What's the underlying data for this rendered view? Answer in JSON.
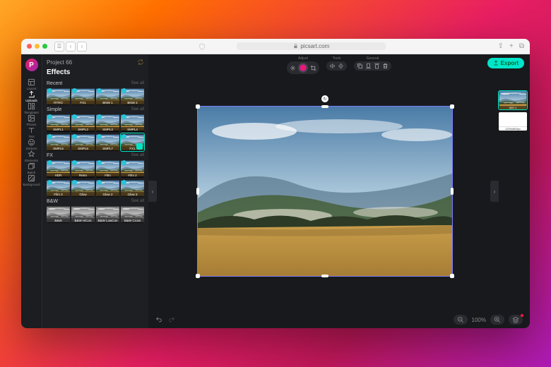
{
  "browser": {
    "url": "picsart.com",
    "lock": "lock-icon"
  },
  "project": {
    "name": "Project 66"
  },
  "panel": {
    "title": "Effects"
  },
  "nav": [
    {
      "icon": "layout",
      "label": "Layout"
    },
    {
      "icon": "upload",
      "label": "Uploads",
      "active": true
    },
    {
      "icon": "templates",
      "label": "Templates"
    },
    {
      "icon": "photos",
      "label": "Photos"
    },
    {
      "icon": "text",
      "label": "Text"
    },
    {
      "icon": "stickers",
      "label": "Stickers"
    },
    {
      "icon": "elements",
      "label": "Elements"
    },
    {
      "icon": "batch",
      "label": "Batch"
    },
    {
      "icon": "background",
      "label": "Background"
    }
  ],
  "sections": [
    {
      "name": "Recent",
      "see": "See all",
      "items": [
        {
          "label": "RTRO",
          "badge": true
        },
        {
          "label": "FX1",
          "badge": true
        },
        {
          "label": "BNW 1",
          "badge": true
        },
        {
          "label": "BNW 2",
          "badge": true
        }
      ]
    },
    {
      "name": "Simple",
      "see": "See all",
      "items": [
        {
          "label": "SMPL1",
          "badge": true
        },
        {
          "label": "SMPL2",
          "badge": true
        },
        {
          "label": "SMPL3",
          "badge": true
        },
        {
          "label": "SMPL4",
          "badge": true
        },
        {
          "label": "SMPL5",
          "badge": true
        },
        {
          "label": "SMPL6",
          "badge": true
        },
        {
          "label": "SMPL7",
          "badge": true
        },
        {
          "label": "FX1",
          "badge": true,
          "selected": true
        }
      ]
    },
    {
      "name": "FX",
      "see": "See all",
      "items": [
        {
          "label": "HDR",
          "badge": true
        },
        {
          "label": "Retro",
          "badge": true
        },
        {
          "label": "Film",
          "badge": true
        },
        {
          "label": "Film 2",
          "badge": true
        },
        {
          "label": "Film 3",
          "badge": true
        },
        {
          "label": "Glow",
          "badge": true
        },
        {
          "label": "Glow 2",
          "badge": true
        },
        {
          "label": "Glow 3",
          "badge": true
        }
      ]
    },
    {
      "name": "B&W",
      "see": "See all",
      "bw": true,
      "items": [
        {
          "label": "B&W"
        },
        {
          "label": "B&W HiCon"
        },
        {
          "label": "B&W LowCon"
        },
        {
          "label": "B&W Cross"
        }
      ]
    }
  ],
  "toolbar": {
    "groups": [
      {
        "label": "Adjust",
        "icons": [
          "adjust",
          "color",
          "crop"
        ]
      },
      {
        "label": "Tools",
        "icons": [
          "flip-h",
          "flip-v"
        ]
      },
      {
        "label": "General",
        "icons": [
          "duplicate",
          "front",
          "back",
          "delete"
        ]
      }
    ]
  },
  "export": {
    "label": "Export"
  },
  "zoom": {
    "value": "100%"
  },
  "layers": [
    {
      "label": "IMG 1",
      "selected": true,
      "type": "image"
    },
    {
      "label": "1200x800px",
      "type": "blank"
    }
  ]
}
